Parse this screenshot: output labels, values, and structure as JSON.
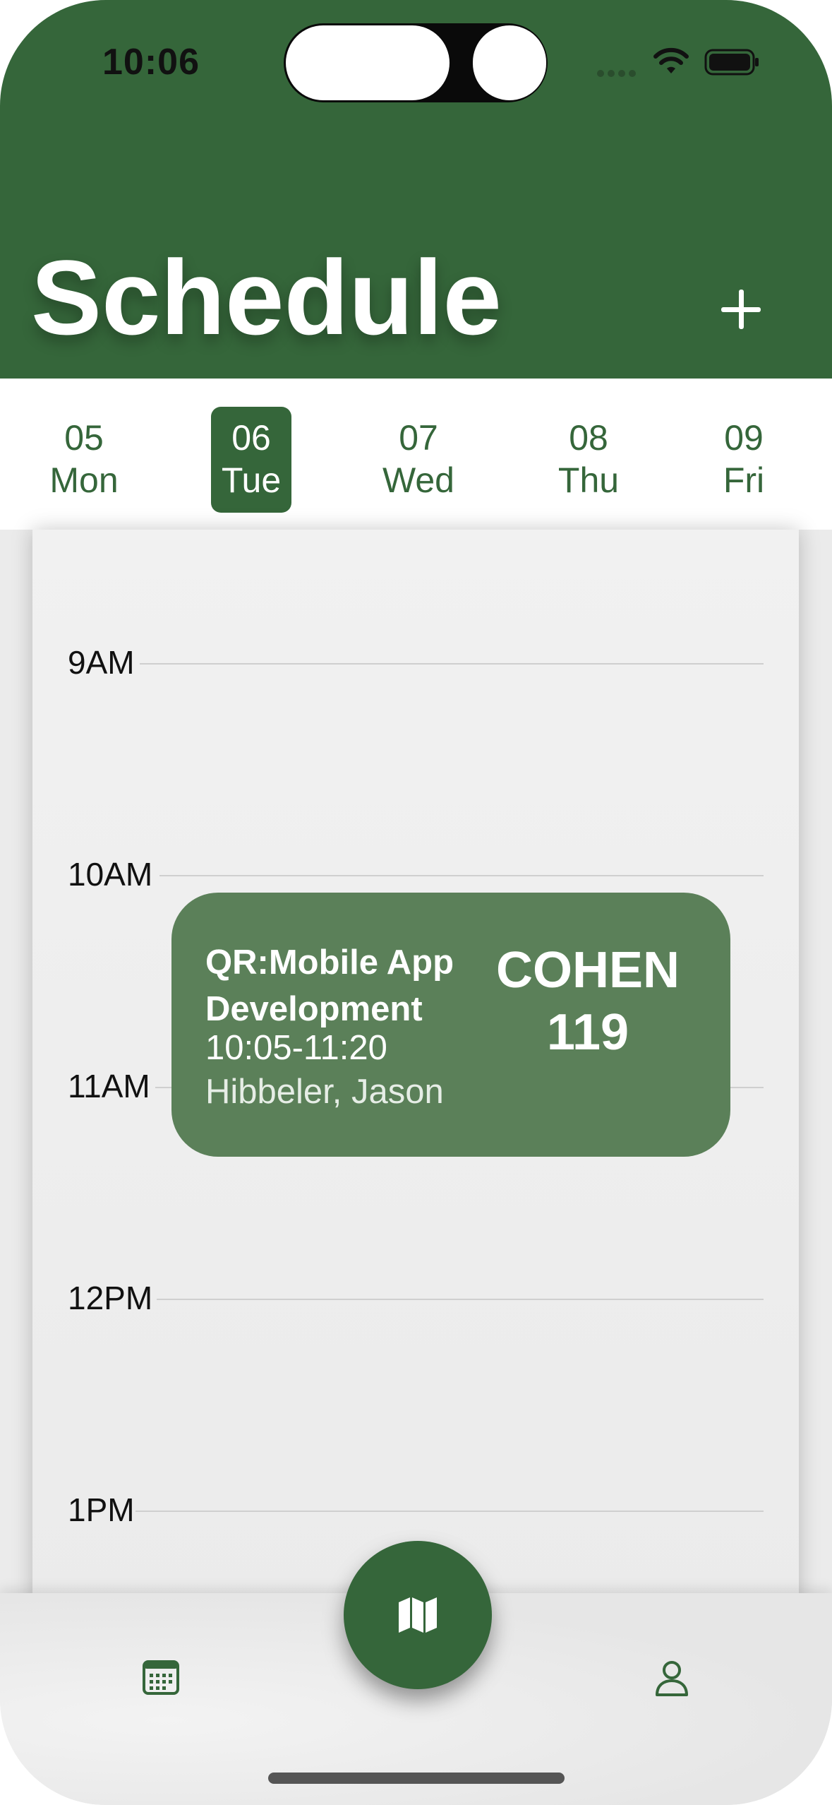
{
  "status_bar": {
    "time": "10:06"
  },
  "header": {
    "title": "Schedule",
    "add_icon": "plus-icon",
    "accent_color": "#35663a"
  },
  "days": [
    {
      "num": "05",
      "name": "Mon",
      "selected": false
    },
    {
      "num": "06",
      "name": "Tue",
      "selected": true
    },
    {
      "num": "07",
      "name": "Wed",
      "selected": false
    },
    {
      "num": "08",
      "name": "Thu",
      "selected": false
    },
    {
      "num": "09",
      "name": "Fri",
      "selected": false
    }
  ],
  "timeline": {
    "hours": [
      "9AM",
      "10AM",
      "11AM",
      "12PM",
      "1PM"
    ]
  },
  "event": {
    "title": "QR:Mobile App Development",
    "time": "10:05-11:20",
    "instructor": "Hibbeler, Jason",
    "room": "COHEN 119",
    "color": "#5b8059"
  },
  "tab_bar": {
    "left_icon": "calendar-icon",
    "center_icon": "map-icon",
    "right_icon": "person-icon"
  }
}
